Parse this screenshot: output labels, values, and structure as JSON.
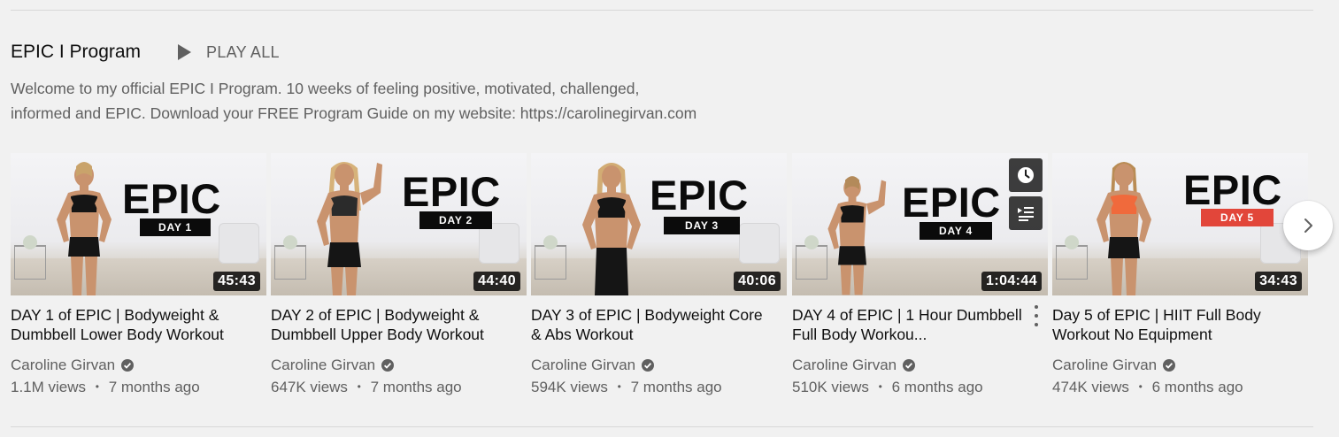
{
  "shelf": {
    "title": "EPIC I Program",
    "play_all_label": "PLAY ALL",
    "description_line1": "Welcome to my official EPIC I Program. 10 weeks of feeling positive, motivated, challenged,",
    "description_line2": "informed and EPIC. Download your FREE Program Guide on my website: https://carolinegirvan.com"
  },
  "videos": [
    {
      "thumb_word": "EPIC",
      "thumb_badge": "DAY 1",
      "badge_color": "#0b0b0b",
      "duration": "45:43",
      "title": "DAY 1 of EPIC | Bodyweight & Dumbbell Lower Body Workout",
      "channel": "Caroline Girvan",
      "views": "1.1M views",
      "age": "7 months ago"
    },
    {
      "thumb_word": "EPIC",
      "thumb_badge": "DAY 2",
      "badge_color": "#0b0b0b",
      "duration": "44:40",
      "title": "DAY 2 of EPIC | Bodyweight & Dumbbell Upper Body Workout",
      "channel": "Caroline Girvan",
      "views": "647K views",
      "age": "7 months ago"
    },
    {
      "thumb_word": "EPIC",
      "thumb_badge": "DAY 3",
      "badge_color": "#0b0b0b",
      "duration": "40:06",
      "title": "DAY 3 of EPIC | Bodyweight Core & Abs Workout",
      "channel": "Caroline Girvan",
      "views": "594K views",
      "age": "7 months ago"
    },
    {
      "thumb_word": "EPIC",
      "thumb_badge": "DAY 4",
      "badge_color": "#0b0b0b",
      "duration": "1:04:44",
      "title": "DAY 4 of EPIC | 1 Hour Dumbbell Full Body Workou...",
      "channel": "Caroline Girvan",
      "views": "510K views",
      "age": "6 months ago"
    },
    {
      "thumb_word": "EPIC",
      "thumb_badge": "DAY 5",
      "badge_color": "#e2463a",
      "duration": "34:43",
      "title": "Day 5 of EPIC | HIIT Full Body Workout No Equipment",
      "channel": "Caroline Girvan",
      "views": "474K views",
      "age": "6 months ago"
    }
  ],
  "separator": "•",
  "icons": {
    "play": "play-icon",
    "verified": "verified-check-icon",
    "watch_later": "clock-icon",
    "add_to_queue": "add-to-queue-icon",
    "menu": "more-vertical-icon",
    "next": "chevron-right-icon"
  }
}
